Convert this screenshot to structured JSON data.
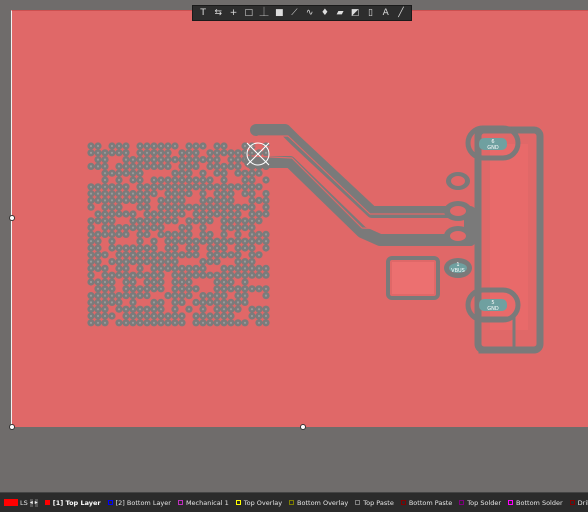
{
  "toolbar": {
    "icons": [
      "filter-icon",
      "route-icon",
      "cross-icon",
      "select-rect-icon",
      "align-icon",
      "fill-icon",
      "track-icon",
      "diff-pair-icon",
      "via-icon",
      "polygon-icon",
      "rule-icon",
      "measure-icon",
      "text-icon",
      "line-icon"
    ],
    "glyphs": [
      "T",
      "⇆",
      "+",
      "□",
      "⏊",
      "■",
      "⟋",
      "∿",
      "♦",
      "▰",
      "◩",
      "▯",
      "A",
      "╱"
    ]
  },
  "pads": {
    "gnd_top": {
      "number": "6",
      "net": "GND"
    },
    "gnd_bottom": {
      "number": "5",
      "net": "GND"
    },
    "vbus": {
      "number": "1",
      "net": "VBUS"
    }
  },
  "layer_bar": {
    "ls_label": "LS",
    "nav_prev": "◂",
    "nav_next": "▸",
    "layers": [
      {
        "label": "[1] Top Layer",
        "color": "#ff0000",
        "active": true
      },
      {
        "label": "[2] Bottom Layer",
        "color": "#0000ff",
        "active": false
      },
      {
        "label": "Mechanical 1",
        "color": "#c030c0",
        "active": false
      },
      {
        "label": "Top Overlay",
        "color": "#ffff00",
        "active": false
      },
      {
        "label": "Bottom Overlay",
        "color": "#808000",
        "active": false
      },
      {
        "label": "Top Paste",
        "color": "#808080",
        "active": false
      },
      {
        "label": "Bottom Paste",
        "color": "#800000",
        "active": false
      },
      {
        "label": "Top Solder",
        "color": "#800080",
        "active": false
      },
      {
        "label": "Bottom Solder",
        "color": "#ff00ff",
        "active": false
      },
      {
        "label": "Drill Guide",
        "color": "#800000",
        "active": false
      }
    ]
  },
  "colors": {
    "board": "#e06868",
    "copper": "#7b7b7b",
    "background": "#6f6c6b"
  }
}
